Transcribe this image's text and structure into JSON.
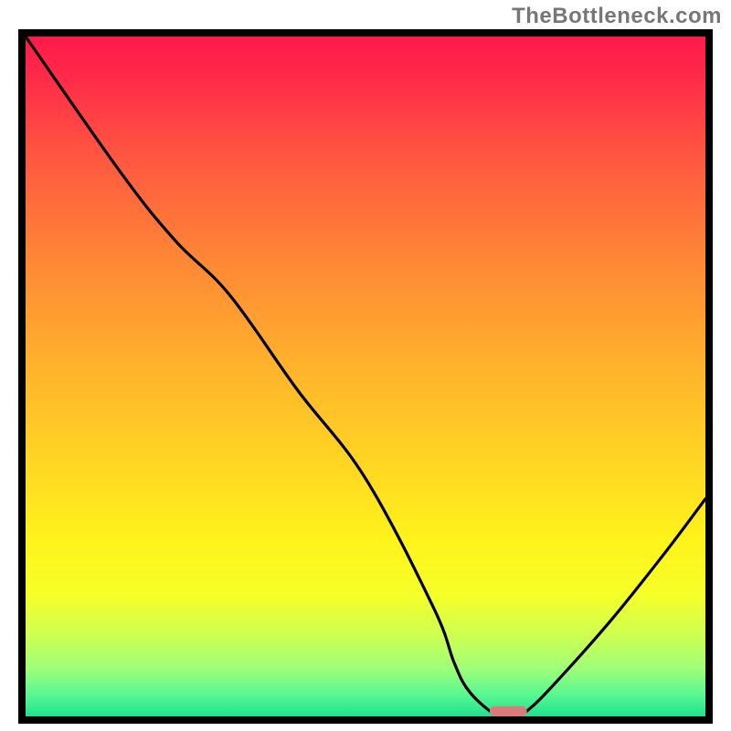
{
  "watermark": {
    "text": "TheBottleneck.com"
  },
  "chart_data": {
    "type": "line",
    "title": "",
    "xlabel": "",
    "ylabel": "",
    "xlim": [
      0,
      100
    ],
    "ylim": [
      0,
      100
    ],
    "grid": false,
    "legend": false,
    "series": [
      {
        "name": "bottleneck-curve",
        "x": [
          0,
          14,
          22,
          30,
          40,
          50,
          60,
          63,
          65,
          68,
          70,
          72,
          74,
          78,
          86,
          94,
          100
        ],
        "values": [
          100,
          80,
          70,
          62,
          48,
          35,
          16,
          8,
          4,
          1,
          0,
          0,
          1,
          5,
          14,
          24,
          32
        ]
      }
    ],
    "marker": {
      "name": "target-marker",
      "x": 71,
      "y": 0,
      "color": "#db7a79",
      "width_pct": 5.5,
      "height_pct": 1.5
    },
    "gradient_stops": [
      {
        "offset": 0,
        "color": "#ff1a4b"
      },
      {
        "offset": 0.05,
        "color": "#ff2749"
      },
      {
        "offset": 0.18,
        "color": "#ff5840"
      },
      {
        "offset": 0.32,
        "color": "#ff8436"
      },
      {
        "offset": 0.48,
        "color": "#ffb12c"
      },
      {
        "offset": 0.62,
        "color": "#ffd423"
      },
      {
        "offset": 0.74,
        "color": "#fff31b"
      },
      {
        "offset": 0.82,
        "color": "#f6ff28"
      },
      {
        "offset": 0.88,
        "color": "#ceff50"
      },
      {
        "offset": 0.93,
        "color": "#9eff78"
      },
      {
        "offset": 0.97,
        "color": "#55f792"
      },
      {
        "offset": 1.0,
        "color": "#1fe08d"
      }
    ]
  }
}
